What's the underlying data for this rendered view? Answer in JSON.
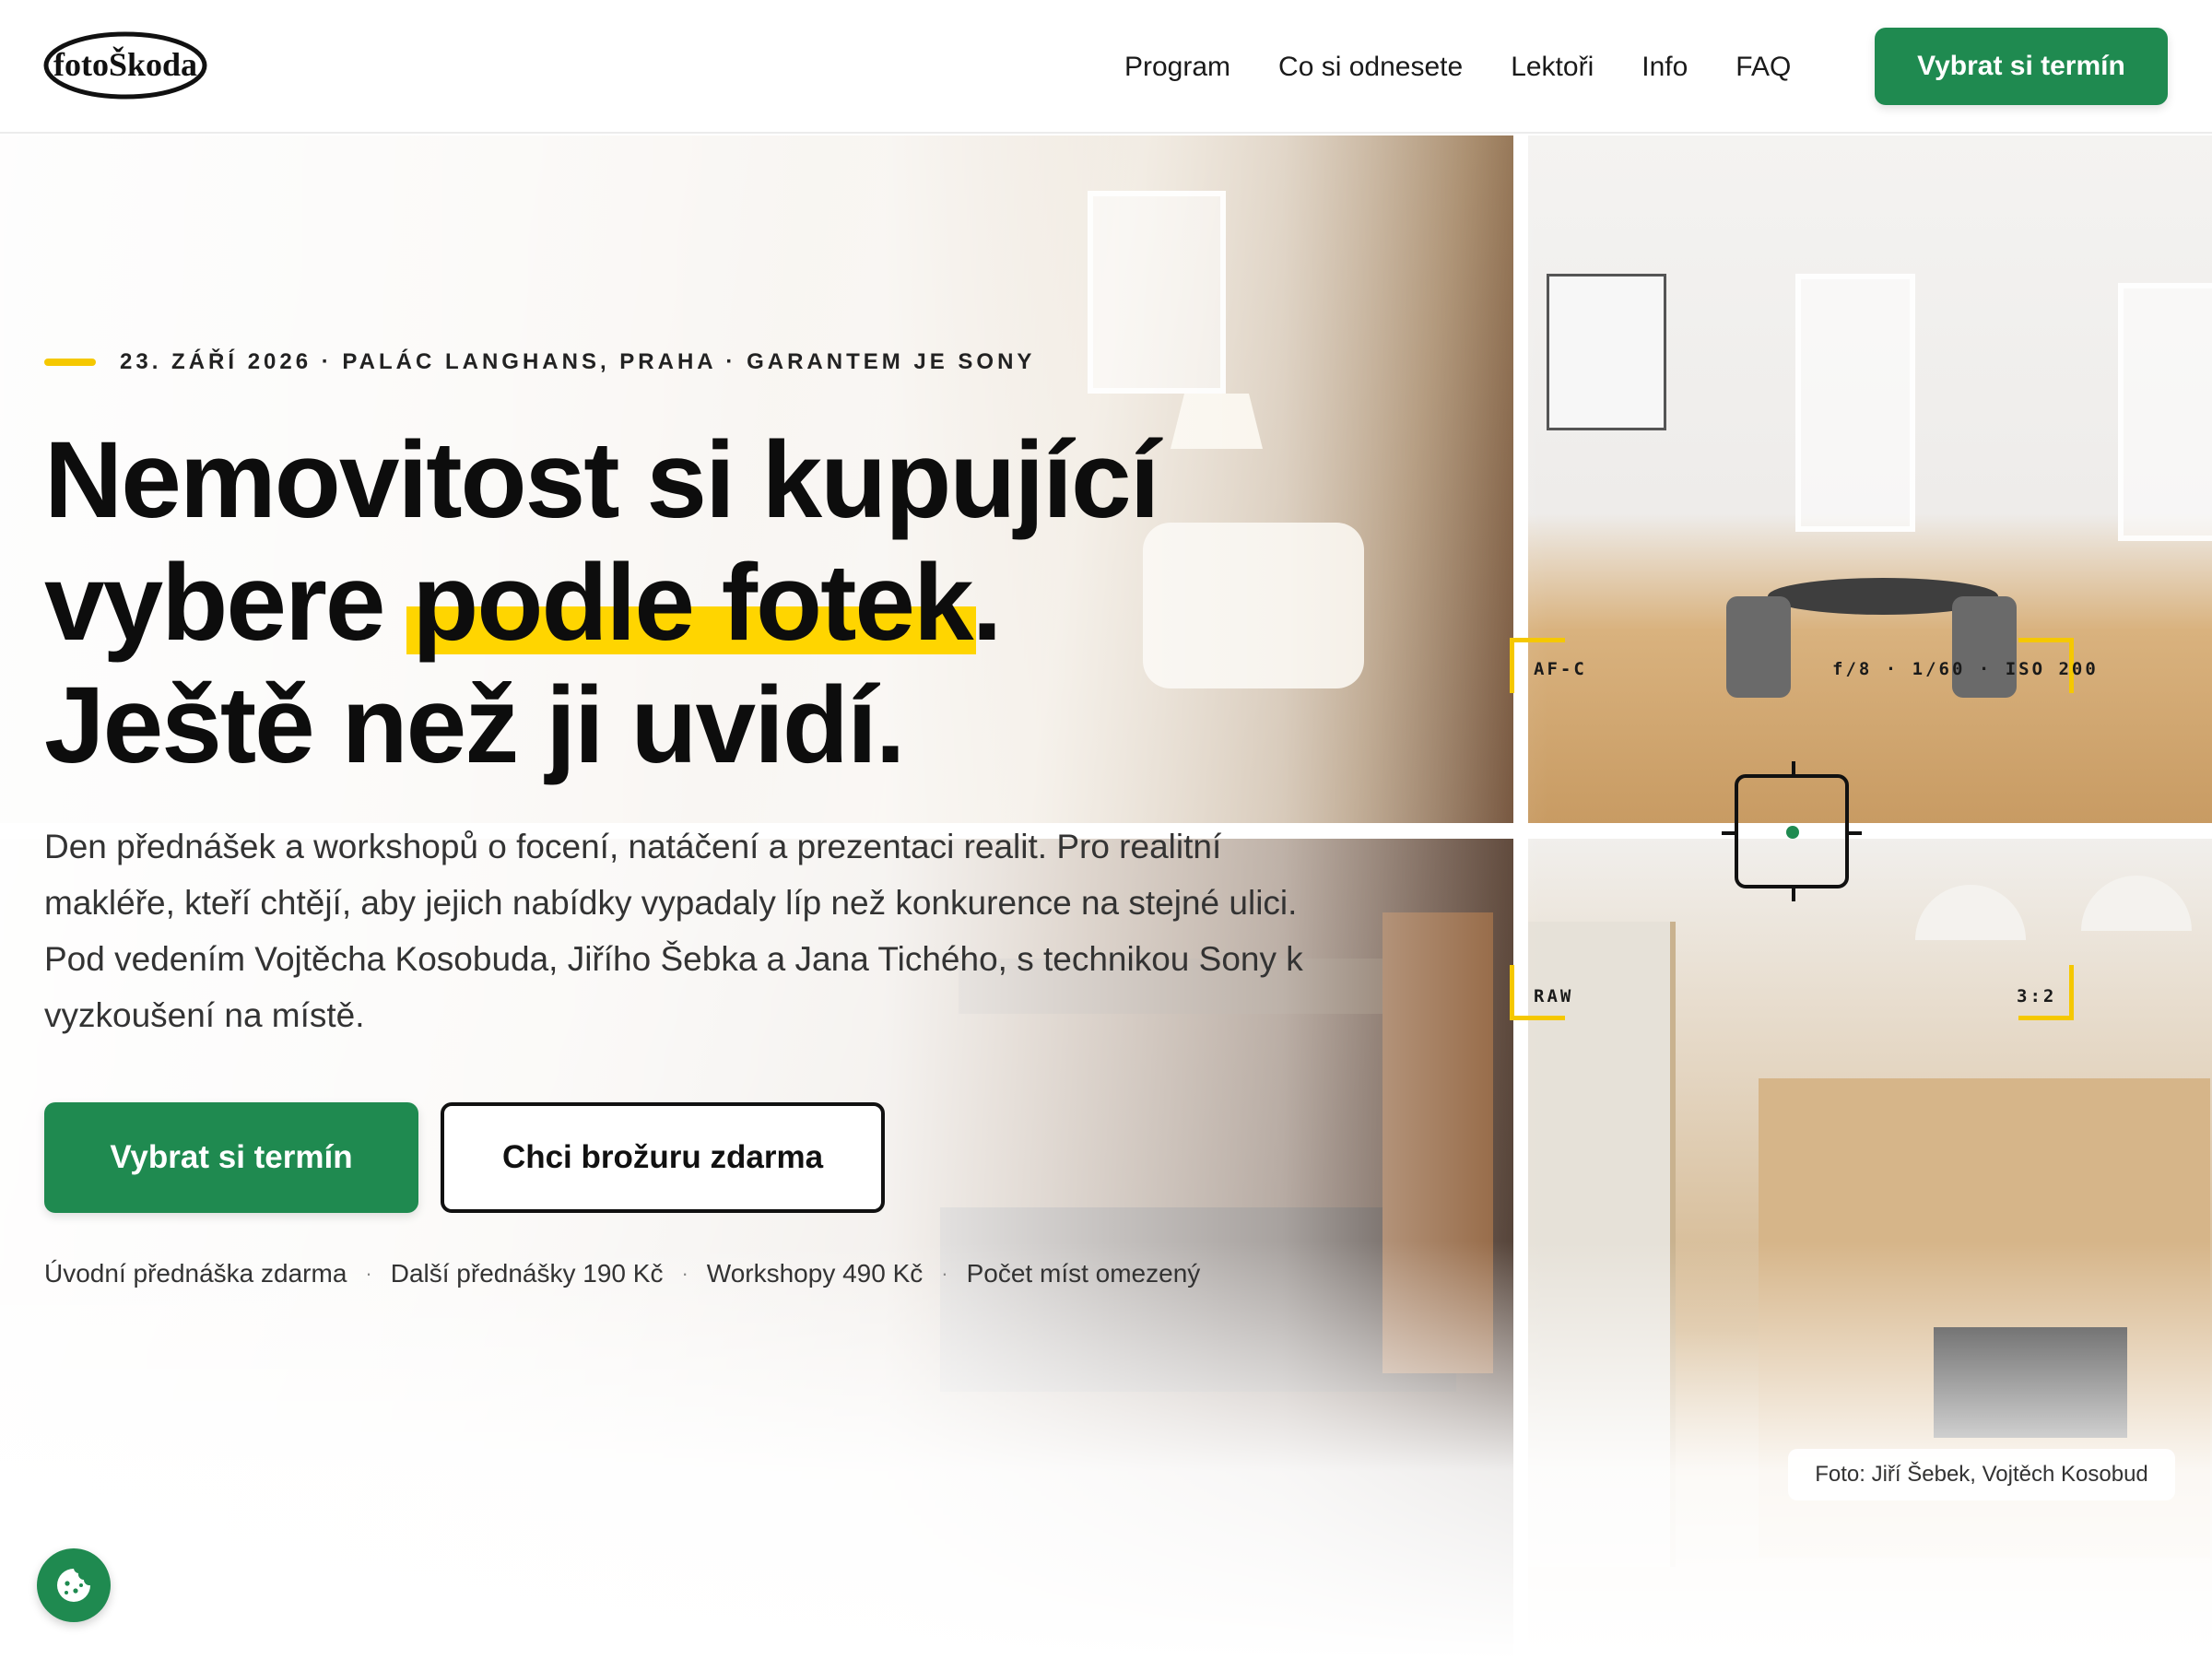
{
  "header": {
    "logo_text": "fotoŠkoda",
    "nav": [
      {
        "label": "Program"
      },
      {
        "label": "Co si odnesete"
      },
      {
        "label": "Lektoři"
      },
      {
        "label": "Info"
      },
      {
        "label": "FAQ"
      }
    ],
    "cta_label": "Vybrat si termín"
  },
  "hero": {
    "eyebrow": "23. ZÁŘÍ 2026 · PALÁC LANGHANS, PRAHA · GARANTEM JE SONY",
    "headline_line1": "Nemovitost si kupující",
    "headline_line2_pre": "vybere ",
    "headline_highlight": "podle fotek",
    "headline_line2_post": ".",
    "headline_line3": "Ještě než ji uvidí.",
    "lead": "Den přednášek a workshopů o focení, natáčení a prezentaci realit. Pro realitní makléře, kteří chtějí, aby jejich nabídky vypadaly líp než konkurence na stejné ulici. Pod vedením Vojtěcha Kosobuda, Jiřího Šebka a Jana Tichého, s technikou Sony k vyzkoušení na místě.",
    "primary_button": "Vybrat si termín",
    "secondary_button": "Chci brožuru zdarma",
    "pricing": [
      "Úvodní přednáška zdarma",
      "Další přednášky 190 Kč",
      "Workshopy 490 Kč",
      "Počet míst omezený"
    ],
    "pricing_separator": "·",
    "viewfinder": {
      "top_left": "AF-C",
      "top_right": "f/8 · 1/60 · ISO 200",
      "bottom_left": "RAW",
      "bottom_right": "3:2"
    },
    "photo_credit": "Foto: Jiří Šebek, Vojtěch Kosobud"
  },
  "colors": {
    "brand_green": "#1f8a50",
    "highlight_yellow": "#ffd500",
    "viewfinder_yellow": "#f5c800",
    "text_dark": "#0d0d0d"
  },
  "icons": {
    "cookie_button": "cookie-icon"
  }
}
